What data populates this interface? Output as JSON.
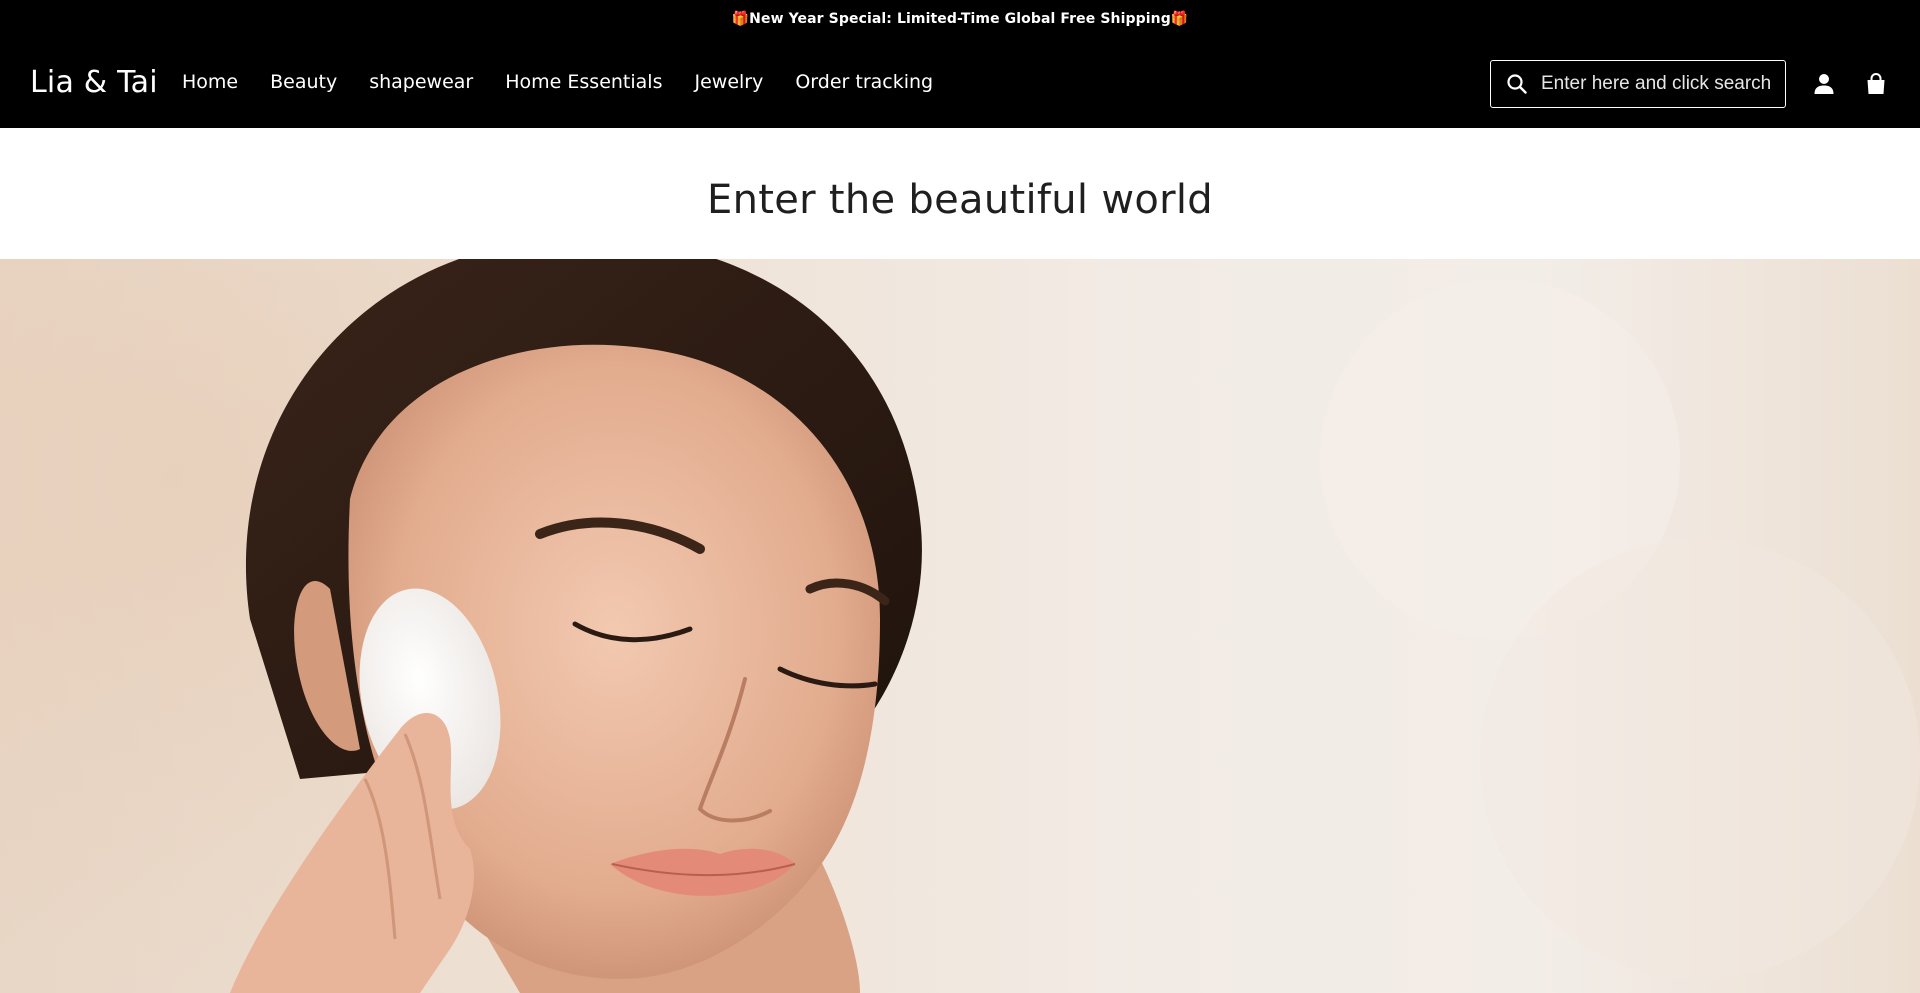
{
  "announcement": {
    "text": "🎁New Year Special: Limited-Time Global Free Shipping🎁"
  },
  "header": {
    "logo": "Lia & Tai",
    "nav": [
      {
        "label": "Home"
      },
      {
        "label": "Beauty"
      },
      {
        "label": "shapewear"
      },
      {
        "label": "Home Essentials"
      },
      {
        "label": "Jewelry"
      },
      {
        "label": "Order tracking"
      }
    ],
    "search": {
      "placeholder": "Enter here and click search",
      "value": ""
    },
    "icons": [
      "search-icon",
      "account-icon",
      "cart-icon"
    ]
  },
  "section": {
    "title": "Enter the beautiful world"
  },
  "colors": {
    "header_bg": "#000000",
    "header_text": "#ffffff",
    "title_text": "#1f1f1f",
    "hero_bg": "#efe3d7"
  }
}
